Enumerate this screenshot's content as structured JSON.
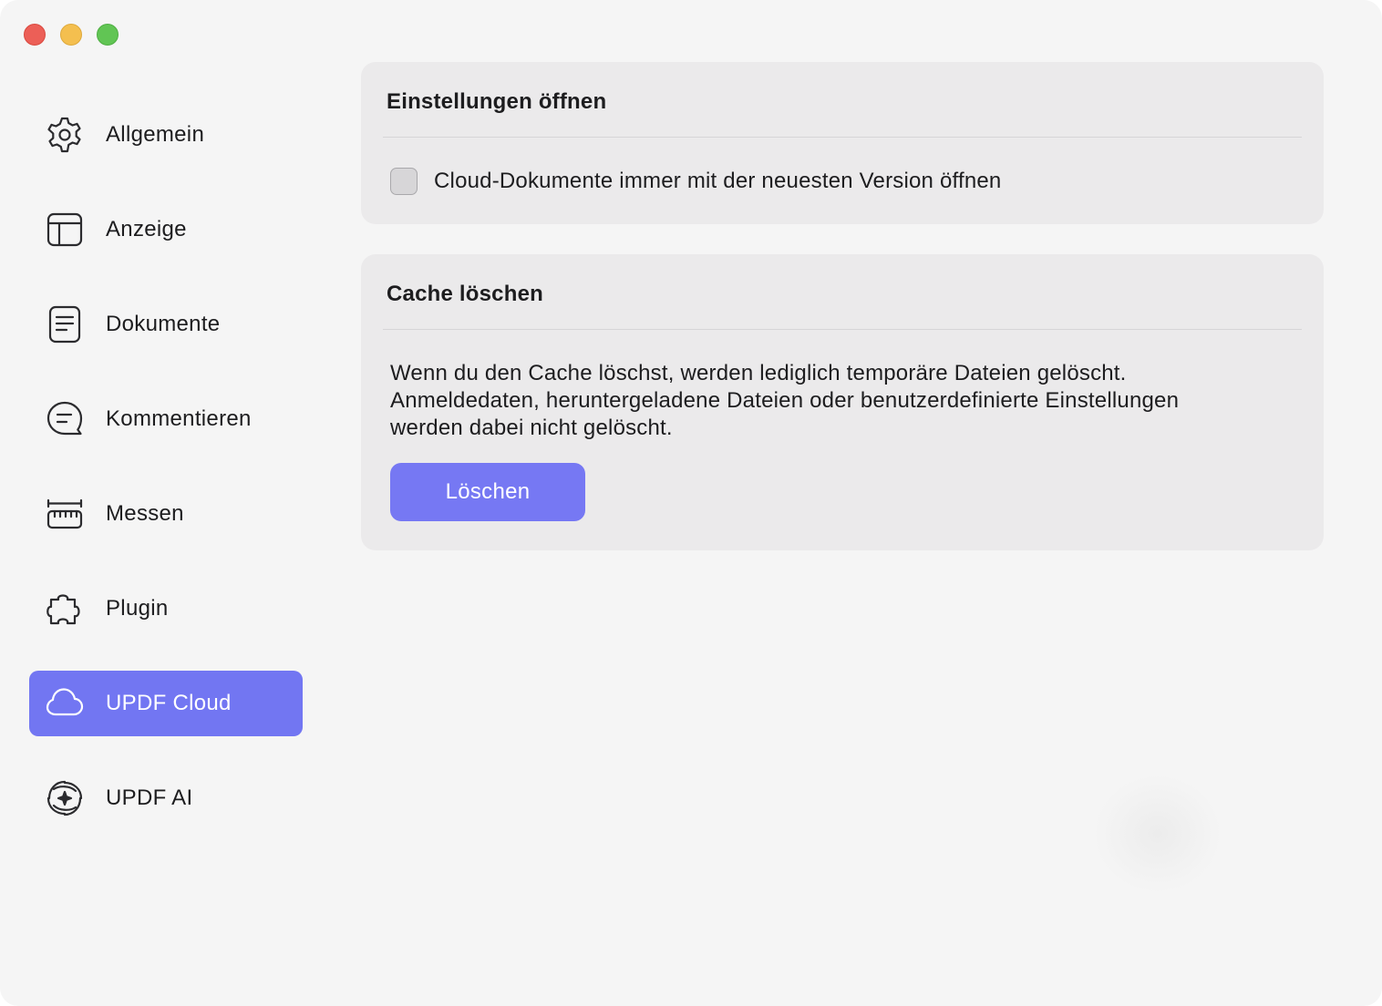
{
  "window": {
    "controls": [
      "close",
      "minimize",
      "zoom"
    ]
  },
  "sidebar": {
    "items": [
      {
        "label": "Allgemein",
        "icon": "gear-icon",
        "active": false
      },
      {
        "label": "Anzeige",
        "icon": "layout-icon",
        "active": false
      },
      {
        "label": "Dokumente",
        "icon": "document-icon",
        "active": false
      },
      {
        "label": "Kommentieren",
        "icon": "comment-icon",
        "active": false
      },
      {
        "label": "Messen",
        "icon": "ruler-icon",
        "active": false
      },
      {
        "label": "Plugin",
        "icon": "puzzle-icon",
        "active": false
      },
      {
        "label": "UPDF Cloud",
        "icon": "cloud-icon",
        "active": true
      },
      {
        "label": "UPDF AI",
        "icon": "ai-icon",
        "active": false
      }
    ]
  },
  "open_settings": {
    "title": "Einstellungen öffnen",
    "checkbox_label": "Cloud-Dokumente immer mit der neuesten Version öffnen",
    "checked": false
  },
  "clear_cache": {
    "title": "Cache löschen",
    "description_lines": [
      "Wenn du den Cache löschst, werden lediglich temporäre Dateien gelöscht.",
      "Anmeldedaten, heruntergeladene Dateien oder benutzerdefinierte Einstellungen",
      "werden dabei nicht gelöscht."
    ],
    "button_label": "Löschen"
  },
  "colors": {
    "accent": "#7276f2",
    "card_background": "#ebeaeb",
    "window_background": "#f5f5f5"
  }
}
